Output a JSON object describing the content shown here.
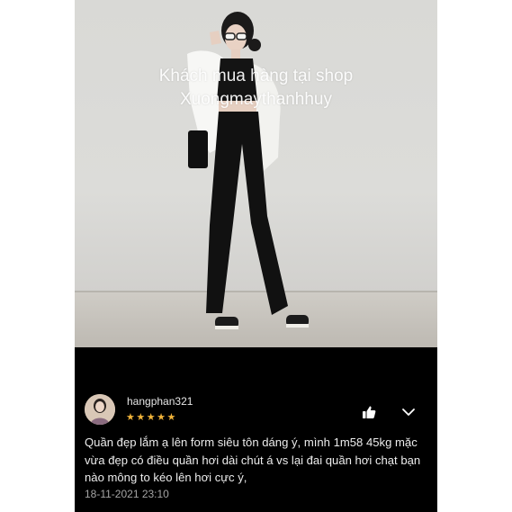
{
  "photo": {
    "overlay_line1": "Khách mua hàng tại shop",
    "overlay_line2": "Xuongmaythanhhuy"
  },
  "review": {
    "username": "hangphan321",
    "rating": 5,
    "stars": "★★★★★",
    "comment": "Quần đẹp lắm ạ lên form siêu tôn dáng ý, mình 1m58 45kg mặc vừa đẹp có điều quần hơi dài chút á vs lại đai quần hơi chạt bạn nào mông to kéo lên hơi cực ý,",
    "date": "18-11-2021 23:10"
  },
  "colors": {
    "background": "#000000",
    "star": "#f0b33a",
    "text": "#ececec",
    "muted": "#a5a5a5"
  },
  "icons": {
    "like": "thumbs-up-icon",
    "expand": "chevron-down-icon"
  }
}
